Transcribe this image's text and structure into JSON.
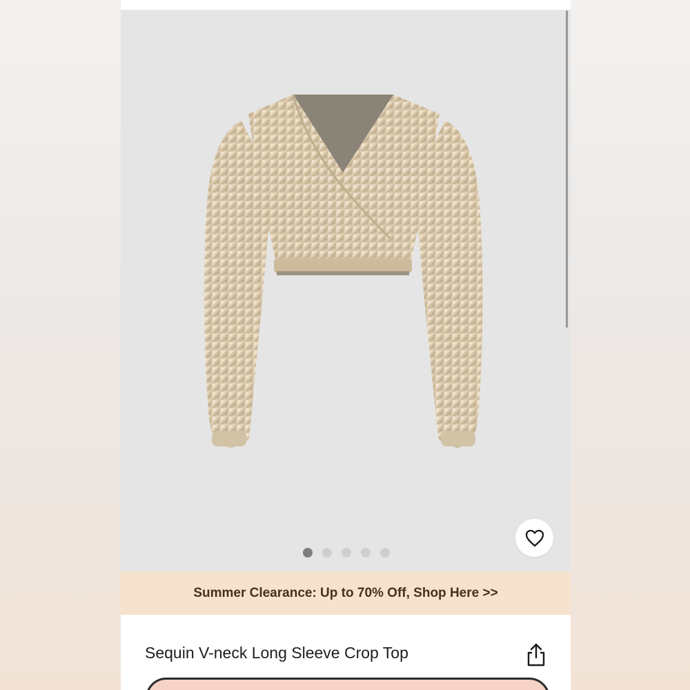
{
  "gallery": {
    "image_alt": "Sequin V-neck Long Sleeve Crop Top",
    "dots_total": 5,
    "active_dot": 0,
    "background_color": "#e5e5e5"
  },
  "favorite": {
    "icon": "heart-outline-icon"
  },
  "promo_banner": {
    "text": "Summer Clearance: Up to 70% Off, Shop Here >>",
    "background_color": "#f7e3cd"
  },
  "product": {
    "title": "Sequin V-neck Long Sleeve Crop Top",
    "share_icon": "share-icon"
  }
}
